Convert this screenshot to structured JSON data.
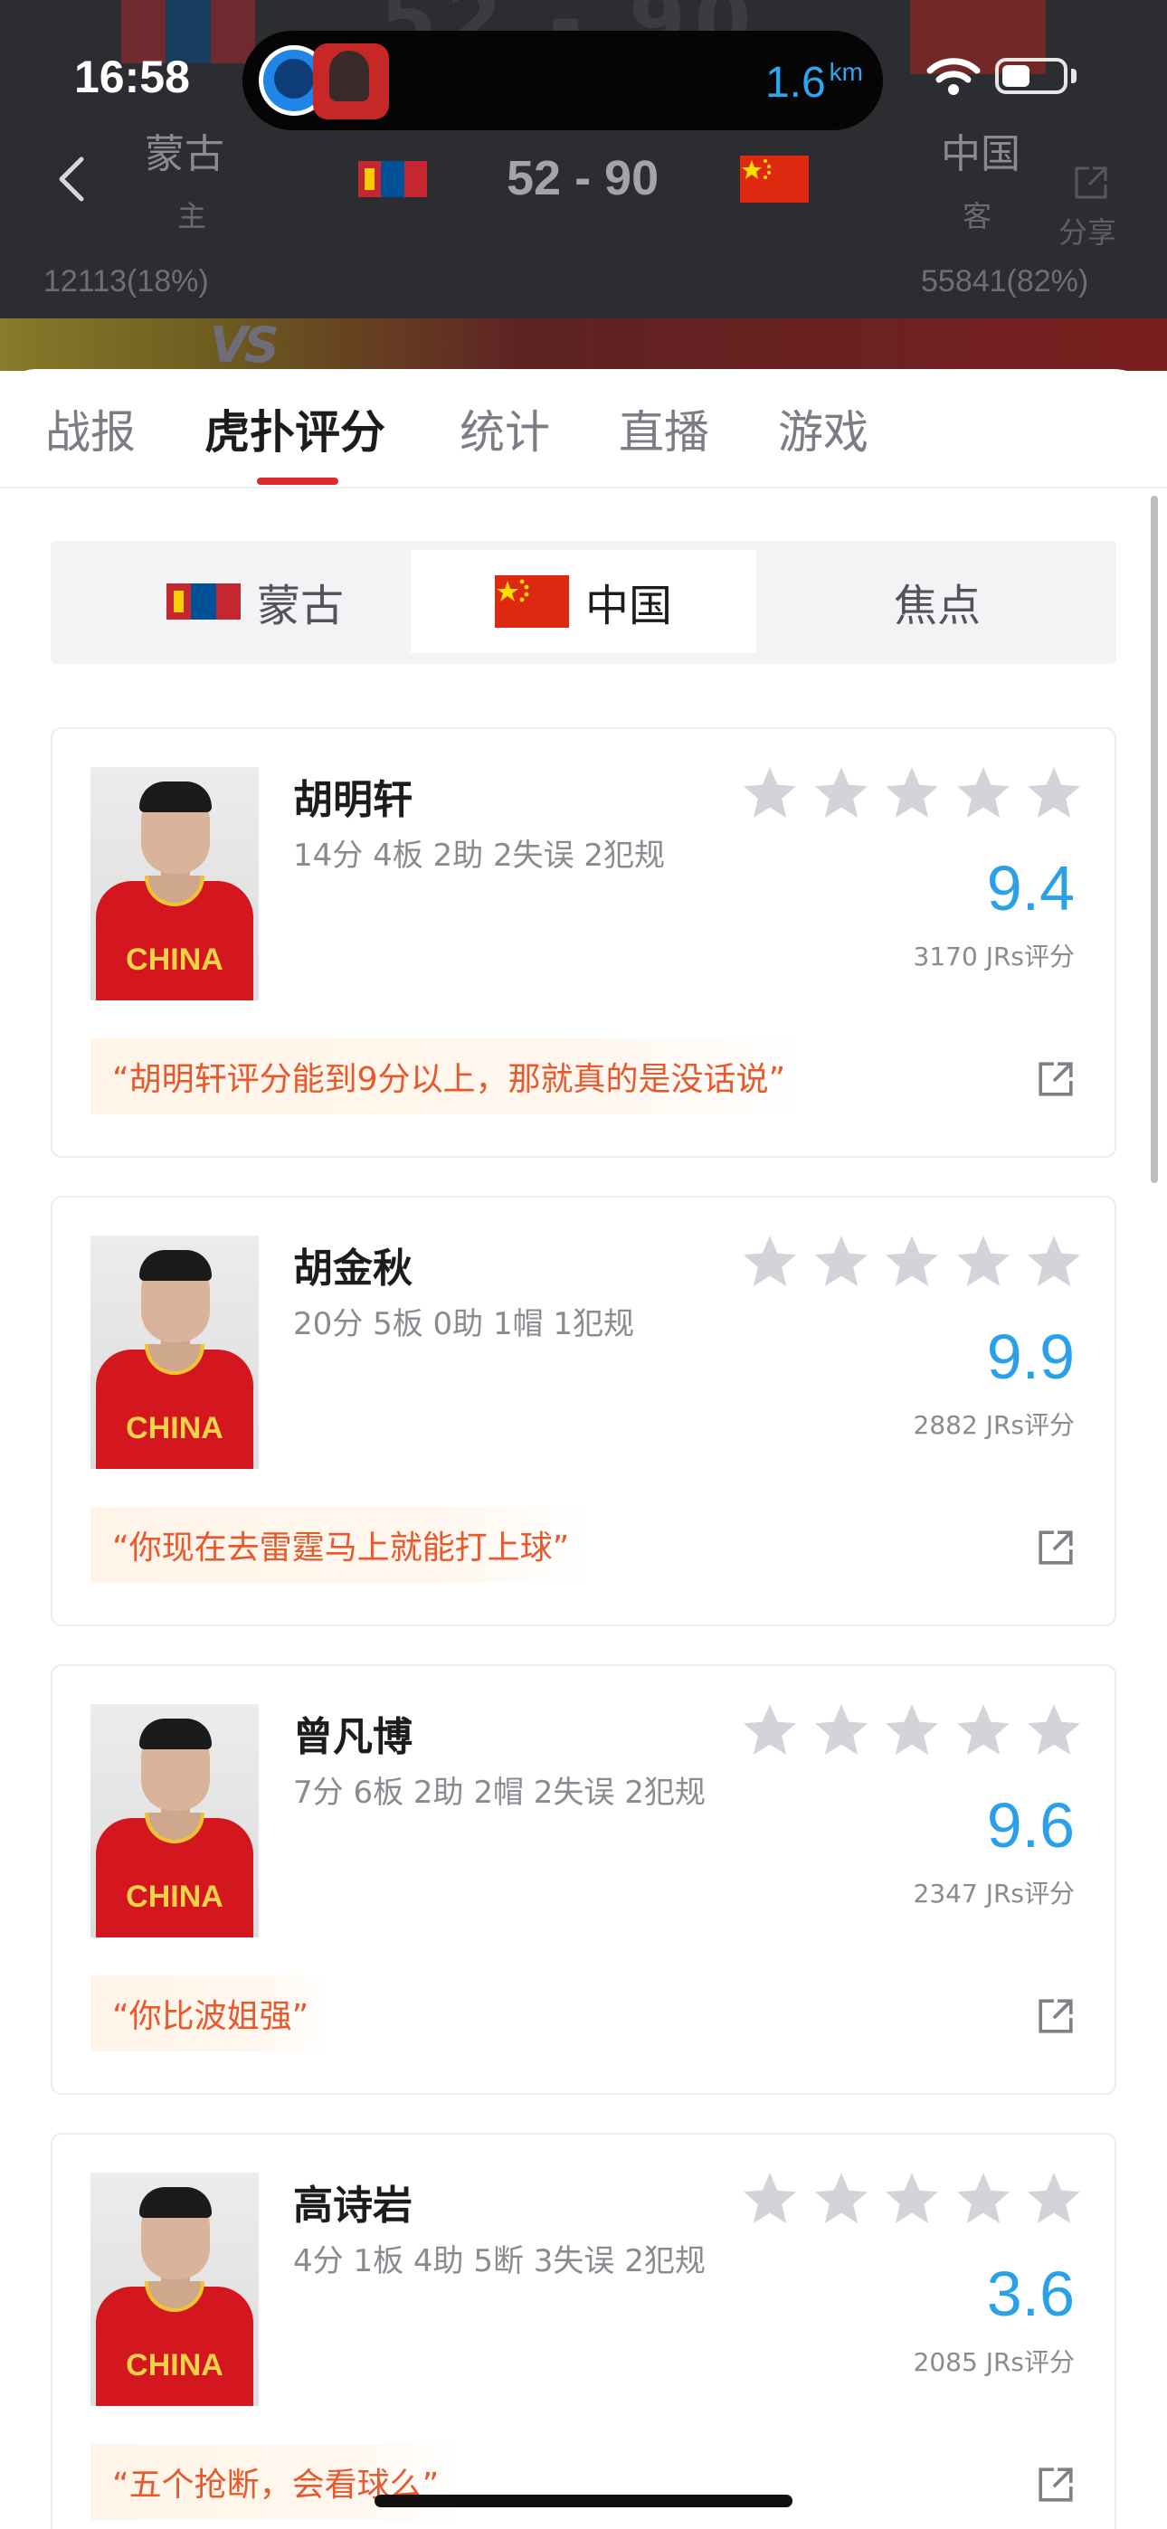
{
  "status_bar": {
    "time": "16:58",
    "distance_value": "1.6",
    "distance_unit": "km"
  },
  "match": {
    "home_team": "蒙古",
    "home_side": "主",
    "away_team": "中国",
    "away_side": "客",
    "score": "52 - 90",
    "share_label": "分享",
    "home_votes": "12113(18%)",
    "away_votes": "55841(82%)",
    "vs": "VS"
  },
  "tabs": [
    {
      "label": "战报"
    },
    {
      "label": "虎扑评分"
    },
    {
      "label": "统计"
    },
    {
      "label": "直播"
    },
    {
      "label": "游戏"
    }
  ],
  "active_tab_index": 1,
  "team_switch": [
    {
      "label": "蒙古"
    },
    {
      "label": "中国"
    },
    {
      "label": "焦点"
    }
  ],
  "active_team_index": 1,
  "players": [
    {
      "name": "胡明轩",
      "stats": "14分 4板 2助 2失误 2犯规",
      "rating": "9.4",
      "votes": "3170 JRs评分",
      "quote": "“胡明轩评分能到9分以上，那就真的是没话说”",
      "jersey_text": "CHINA"
    },
    {
      "name": "胡金秋",
      "stats": "20分 5板 0助 1帽 1犯规",
      "rating": "9.9",
      "votes": "2882 JRs评分",
      "quote": "“你现在去雷霆马上就能打上球”",
      "jersey_text": "CHINA"
    },
    {
      "name": "曾凡博",
      "stats": "7分 6板 2助 2帽 2失误 2犯规",
      "rating": "9.6",
      "votes": "2347 JRs评分",
      "quote": "“你比波姐强”",
      "jersey_text": "CHINA"
    },
    {
      "name": "高诗岩",
      "stats": "4分 1板 4助 5断 3失误 2犯规",
      "rating": "3.6",
      "votes": "2085 JRs评分",
      "quote": "“五个抢断，会看球么”",
      "jersey_text": "CHINA"
    }
  ],
  "colors": {
    "accent_red": "#e0282f",
    "rating_blue": "#2aa0e8",
    "quote_orange": "#e8582a",
    "header_dark": "#2b2d31"
  },
  "icons": {
    "back": "chevron-left-icon",
    "share": "share-icon",
    "star": "star-icon",
    "wifi": "wifi-icon",
    "battery": "battery-icon"
  }
}
